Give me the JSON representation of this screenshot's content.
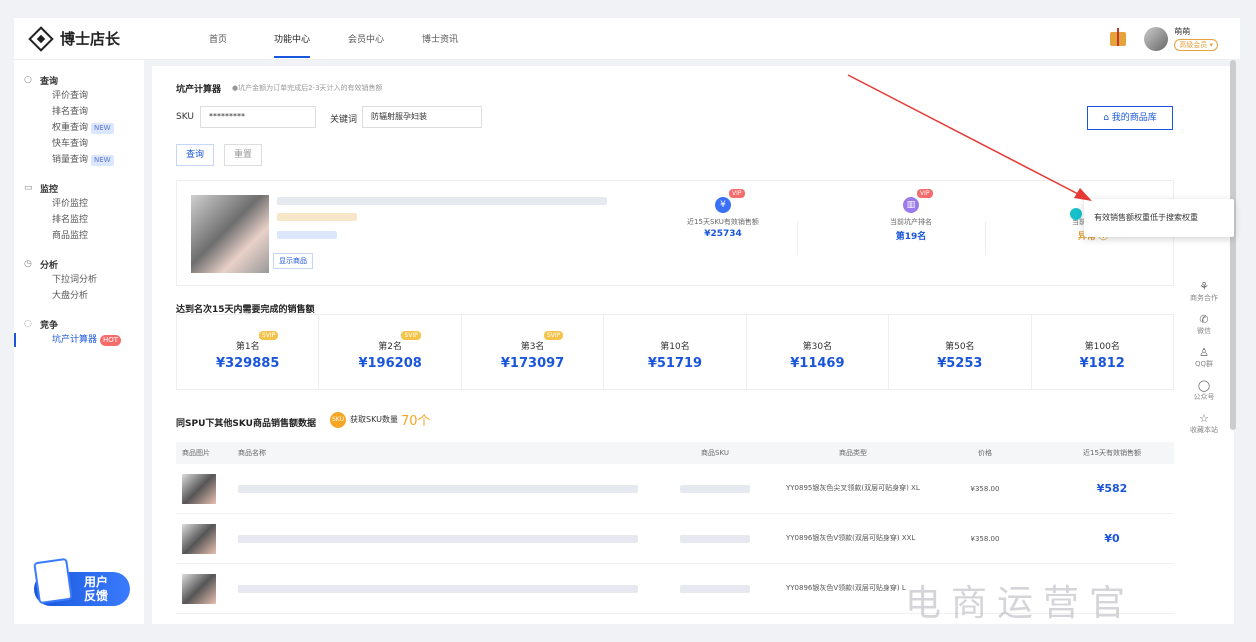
{
  "header": {
    "logo": "博士店长",
    "nav": [
      "首页",
      "功能中心",
      "会员中心",
      "博士资讯"
    ],
    "active_nav": "功能中心",
    "user_name": "萌萌",
    "user_badge": "高级会员 ▾"
  },
  "sidebar": {
    "groups": [
      {
        "title": "查询",
        "icon": "search-icon",
        "items": [
          {
            "label": "评价查询"
          },
          {
            "label": "排名查询"
          },
          {
            "label": "权重查询",
            "tag": "NEW"
          },
          {
            "label": "快车查询"
          },
          {
            "label": "销量查询",
            "tag": "NEW"
          }
        ]
      },
      {
        "title": "监控",
        "icon": "monitor-icon",
        "items": [
          {
            "label": "评价监控"
          },
          {
            "label": "排名监控"
          },
          {
            "label": "商品监控"
          }
        ]
      },
      {
        "title": "分析",
        "icon": "clock-icon",
        "items": [
          {
            "label": "下拉词分析"
          },
          {
            "label": "大盘分析"
          }
        ]
      },
      {
        "title": "竞争",
        "icon": "compete-icon",
        "items": [
          {
            "label": "坑产计算器",
            "tag": "HOT",
            "active": true
          }
        ]
      }
    ],
    "feedback": "用户\n反馈"
  },
  "calculator": {
    "title": "坑产计算器",
    "hint": "●坑产金额为订单完成后2-3天计入的有效销售额",
    "sku_label": "SKU",
    "sku_value": "*********",
    "keyword_label": "关键词",
    "keyword_value": "防辐射服孕妇装",
    "query_btn": "查询",
    "reset_btn": "重置",
    "library_btn": "我的商品库"
  },
  "product": {
    "show_btn": "显示商品",
    "metrics": [
      {
        "label": "近15天SKU有效销售额",
        "value": "¥25734",
        "vip": "VIP",
        "icon": "¥"
      },
      {
        "label": "当前坑产排名",
        "value": "第19名",
        "vip": "VIP",
        "icon": "▥"
      },
      {
        "label": "当前商品权重",
        "value": "异常 ⓘ",
        "vip": "",
        "icon": ""
      }
    ]
  },
  "tooltip": "有效销售额权重低于搜索权重",
  "ranks_title": "达到名次15天内需要完成的销售额",
  "ranks": [
    {
      "name": "第1名",
      "value": "¥329885",
      "svip": "SVIP"
    },
    {
      "name": "第2名",
      "value": "¥196208",
      "svip": "SVIP"
    },
    {
      "name": "第3名",
      "value": "¥173097",
      "svip": "SVIP"
    },
    {
      "name": "第10名",
      "value": "¥51719",
      "svip": ""
    },
    {
      "name": "第30名",
      "value": "¥11469",
      "svip": ""
    },
    {
      "name": "第50名",
      "value": "¥5253",
      "svip": ""
    },
    {
      "name": "第100名",
      "value": "¥1812",
      "svip": ""
    }
  ],
  "spu": {
    "title": "同SPU下其他SKU商品销售额数据",
    "sku_badge": "SKU",
    "sku_label": "获取SKU数量",
    "sku_count": "70个",
    "columns": [
      "商品图片",
      "商品名称",
      "商品SKU",
      "商品类型",
      "价格",
      "近15天有效销售额"
    ],
    "rows": [
      {
        "type": "YY0895银灰色尖叉领款(双层可贴身穿) XL",
        "price": "¥358.00",
        "sales": "¥582"
      },
      {
        "type": "YY0896银灰色V领款(双层可贴身穿) XXL",
        "price": "¥358.00",
        "sales": "¥0"
      },
      {
        "type": "YY0896银灰色V领款(双层可贴身穿) L",
        "price": "",
        "sales": ""
      }
    ]
  },
  "rail": [
    "商务合作",
    "微信",
    "QQ群",
    "公众号",
    "收藏本站"
  ],
  "watermark": "电商运营官",
  "colors": {
    "accent": "#1a56db",
    "arrow": "#e53935",
    "hot": "#f56c6c",
    "svip": "#f6c34a"
  }
}
